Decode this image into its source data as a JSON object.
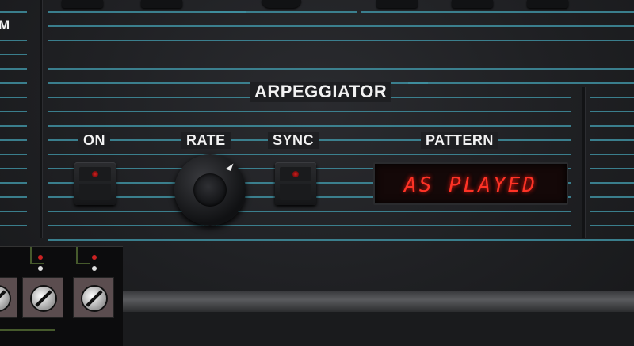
{
  "section": {
    "title": "ARPEGGIATOR"
  },
  "left_edge_label": "M",
  "controls": {
    "on": {
      "label": "ON"
    },
    "rate": {
      "label": "RATE"
    },
    "sync": {
      "label": "SYNC"
    },
    "pattern": {
      "label": "PATTERN",
      "display_value": "AS PLAYED"
    }
  },
  "colors": {
    "stripe": "#3f8fa0",
    "display_text": "#ff3326",
    "panel": "#1f2023"
  }
}
